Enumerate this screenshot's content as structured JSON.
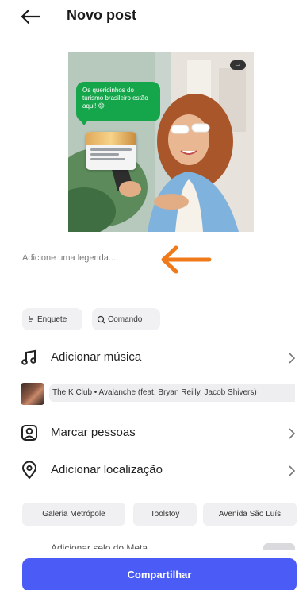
{
  "header": {
    "title": "Novo post"
  },
  "preview": {
    "bubble_text": "Os queridinhos do turismo brasileiro estão aqui! 😊",
    "media_badge": "▭"
  },
  "caption": {
    "placeholder": "Adicione uma legenda..."
  },
  "quick_chips": [
    {
      "label": "Enquete",
      "icon": "poll-icon"
    },
    {
      "label": "Comando",
      "icon": "search-icon"
    }
  ],
  "options": {
    "music": {
      "label": "Adicionar música",
      "icon": "music-note-icon"
    },
    "tag": {
      "label": "Marcar pessoas",
      "icon": "tag-people-icon"
    },
    "location": {
      "label": "Adicionar localização",
      "icon": "location-pin-icon"
    }
  },
  "music_track": {
    "text": "The K Club • Avalanche (feat. Bryan Reilly, Jacob Shivers)"
  },
  "location_suggestions": [
    "Galeria Metrópole",
    "Toolstoy",
    "Avenida São Luís"
  ],
  "ghost_row": {
    "text": "Adicionar selo do Meta"
  },
  "share": {
    "label": "Compartilhar"
  },
  "colors": {
    "accent": "#4a5cf5",
    "bubble": "#15a54a",
    "arrow": "#f07a1a"
  }
}
